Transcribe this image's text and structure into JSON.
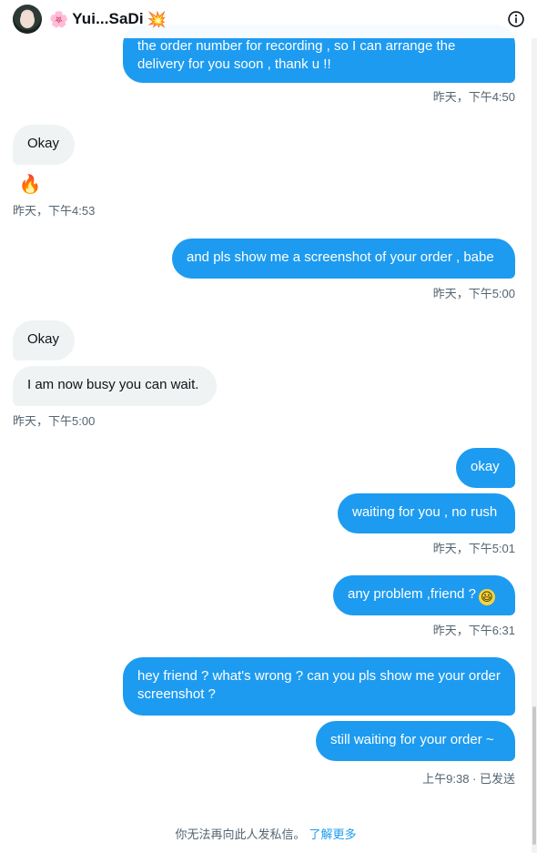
{
  "header": {
    "name_prefix_emoji": "🌸",
    "name": "Yui...SaDi",
    "name_suffix_emoji": "💥"
  },
  "messages": [
    {
      "dir": "out",
      "text": "the order number for recording , so I can arrange the delivery for you soon , thank u !!"
    },
    {
      "dir": "in",
      "text": "Okay"
    },
    {
      "dir": "in",
      "text": "I am now busy you can wait."
    },
    {
      "dir": "out",
      "text": "and pls show me a screenshot of your order , babe"
    },
    {
      "dir": "in",
      "text": "Okay"
    },
    {
      "dir": "out",
      "text": "okay"
    },
    {
      "dir": "out",
      "text": "waiting for you , no rush"
    },
    {
      "dir": "out",
      "text": "any problem ,friend ?",
      "emoji": "😃"
    },
    {
      "dir": "out",
      "text": "hey friend ? what's wrong ? can you pls show me your order screenshot ?"
    },
    {
      "dir": "out",
      "text": "still waiting for your order ~"
    }
  ],
  "timestamps": {
    "t1": "昨天，下午4:50",
    "t2": "昨天，下午4:53",
    "t3": "昨天，下午5:00",
    "t4": "昨天，下午5:00",
    "t5": "昨天，下午5:01",
    "t6": "昨天，下午6:31",
    "t7": "上午9:38 · 已发送"
  },
  "reaction_emoji": "🔥",
  "footer": {
    "note": "你无法再向此人发私信。",
    "link": "了解更多"
  },
  "colors": {
    "accent": "#1d9bf0",
    "incoming_bg": "#eff3f4",
    "timestamp": "#536471"
  },
  "icons": [
    "info-icon"
  ]
}
